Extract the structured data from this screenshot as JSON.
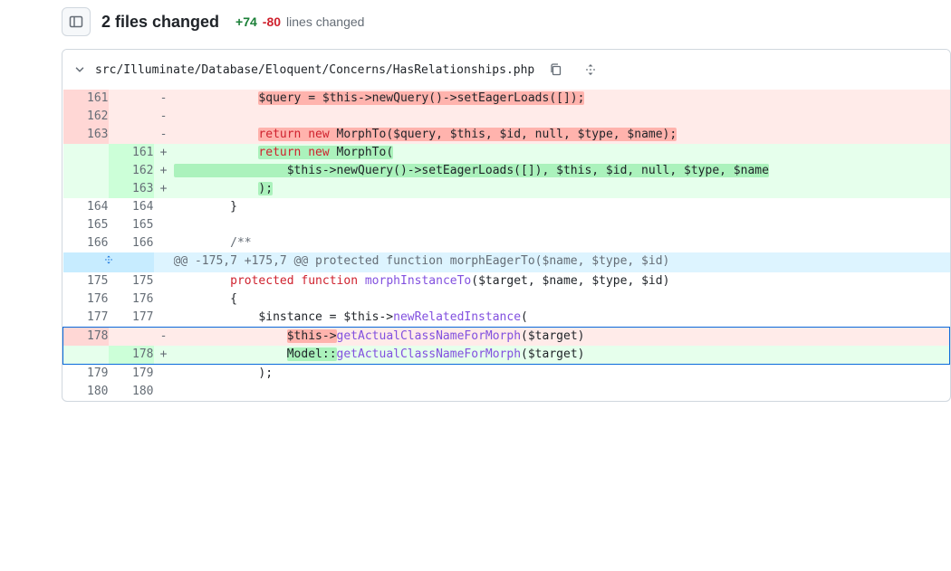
{
  "header": {
    "files_changed": "2 files changed",
    "additions": "+74",
    "deletions": "-80",
    "lines_changed_label": "lines changed"
  },
  "file": {
    "path": "src/Illuminate/Database/Eloquent/Concerns/HasRelationships.php",
    "hunk_header": "@@ -175,7 +175,7 @@ protected function morphEagerTo($name, $type, $id)"
  },
  "rows": [
    {
      "type": "del",
      "old": "161",
      "new": "",
      "marker": "-",
      "html": "            <span class=\"hl-del\">$query = $this-&gt;newQuery()-&gt;setEagerLoads([]);</span>"
    },
    {
      "type": "del",
      "old": "162",
      "new": "",
      "marker": "-",
      "html": ""
    },
    {
      "type": "del",
      "old": "163",
      "new": "",
      "marker": "-",
      "html": "            <span class=\"hl-del\"><span class=\"k-keyword\">return</span> <span class=\"k-keyword\">new</span> MorphTo($query, $this, $id, null, $type, $name);</span>"
    },
    {
      "type": "add",
      "old": "",
      "new": "161",
      "marker": "+",
      "html": "            <span class=\"hl-add\"><span class=\"k-keyword\">return</span> <span class=\"k-keyword\">new</span> MorphTo(</span>"
    },
    {
      "type": "add",
      "old": "",
      "new": "162",
      "marker": "+",
      "html": "<span class=\"hl-add\">                $this-&gt;newQuery()-&gt;setEagerLoads([]), $this, $id, null, $type, $name</span>"
    },
    {
      "type": "add",
      "old": "",
      "new": "163",
      "marker": "+",
      "html": "            <span class=\"hl-add\">);</span>"
    },
    {
      "type": "ctx",
      "old": "164",
      "new": "164",
      "marker": "",
      "html": "        }"
    },
    {
      "type": "ctx",
      "old": "165",
      "new": "165",
      "marker": "",
      "html": ""
    },
    {
      "type": "ctx",
      "old": "166",
      "new": "166",
      "marker": "",
      "html": "        <span class=\"k-comment\">/**</span>"
    },
    {
      "type": "hunk",
      "old": "",
      "new": "",
      "marker": "",
      "html": ""
    },
    {
      "type": "ctx",
      "old": "175",
      "new": "175",
      "marker": "",
      "html": "        <span class=\"k-keyword\">protected</span> <span class=\"k-keyword\">function</span> <span class=\"k-func\">morphInstanceTo</span>($target, $name, $type, $id)"
    },
    {
      "type": "ctx",
      "old": "176",
      "new": "176",
      "marker": "",
      "html": "        {"
    },
    {
      "type": "ctx",
      "old": "177",
      "new": "177",
      "marker": "",
      "html": "            $instance = $this-&gt;<span class=\"k-func\">newRelatedInstance</span>("
    },
    {
      "type": "del",
      "old": "178",
      "new": "",
      "marker": "-",
      "html": "                <span class=\"hl-del\">$this-&gt;</span><span class=\"k-func\">getActualClassNameForMorph</span>($target)",
      "sel": "top"
    },
    {
      "type": "add",
      "old": "",
      "new": "178",
      "marker": "+",
      "html": "                <span class=\"hl-add\">Model::</span><span class=\"k-func\">getActualClassNameForMorph</span>($target)",
      "sel": "bot"
    },
    {
      "type": "ctx",
      "old": "179",
      "new": "179",
      "marker": "",
      "html": "            );"
    },
    {
      "type": "ctx",
      "old": "180",
      "new": "180",
      "marker": "",
      "html": ""
    }
  ]
}
